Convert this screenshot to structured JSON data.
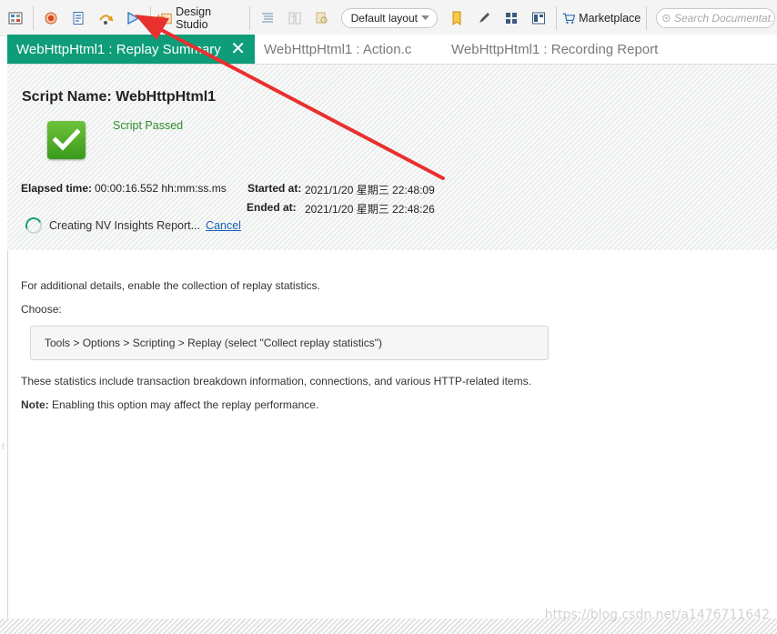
{
  "toolbar": {
    "design_studio_label": "Design Studio",
    "layout_value": "Default layout",
    "marketplace_label": "Marketplace",
    "search_placeholder": "Search Documentat..."
  },
  "tabs": [
    {
      "label": "WebHttpHtml1 : Replay Summary"
    },
    {
      "label": "WebHttpHtml1 : Action.c"
    },
    {
      "label": "WebHttpHtml1 : Recording Report"
    }
  ],
  "summary": {
    "script_name_label": "Script Name:",
    "script_name_value": "WebHttpHtml1",
    "status": "Script Passed",
    "elapsed_label": "Elapsed time:",
    "elapsed_value": "00:00:16.552 hh:mm:ss.ms",
    "started_label": "Started at:",
    "started_value": "2021/1/20 星期三 22:48:09",
    "ended_label": "Ended at:",
    "ended_value": "2021/1/20 星期三 22:48:26",
    "progress_text": "Creating NV Insights Report...",
    "cancel_label": "Cancel"
  },
  "content": {
    "line1": "For additional details, enable the collection of replay statistics.",
    "choose": "Choose:",
    "path": "Tools > Options > Scripting > Replay (select \"Collect replay statistics\")",
    "line2": "These statistics include transaction breakdown information, connections, and various HTTP-related items.",
    "note_label": "Note:",
    "note_text": " Enabling this option may affect the replay performance."
  },
  "watermark": "https://blog.csdn.net/a1476711642",
  "colors": {
    "accent": "#0e9d78",
    "passed": "#2e8b2e",
    "annotation_arrow": "#e8302f"
  }
}
